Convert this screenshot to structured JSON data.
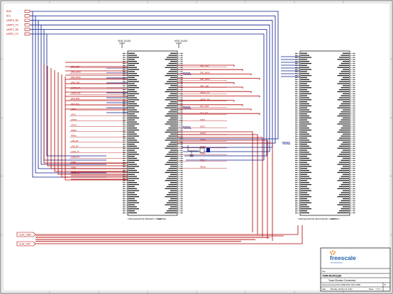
{
  "colors": {
    "red": "#b00000",
    "blue": "#0b1b8a",
    "black": "#000000",
    "border": "#555555",
    "logo_blue": "#1f5fae",
    "logo_orange": "#f28c1e"
  },
  "offsheet_labels": [
    "SDA",
    "SCL",
    "UART0_RX",
    "UART0_TX",
    "UART1_RX",
    "UART1_TX"
  ],
  "connector_a": {
    "rail_left": "VDD_ELEV",
    "rail_right": "VDD_ELEV",
    "ref": "J1",
    "part": "TWR ELEVATOR PRIMARY CONN",
    "type": "SAMTEC"
  },
  "connector_b": {
    "ref": "J2",
    "part": "TWR ELEVATOR SECONDARY CONN",
    "type": "SAMTEC"
  },
  "net_labels_left": [
    "SPI0_SCK",
    "SPI0_MOSI",
    "SPI0_MISO",
    "SPI0_CS0",
    "UART0_TX",
    "UART0_RX",
    "I2C0_SDA",
    "I2C0_SCL",
    "ADC0",
    "ADC1",
    "GPIO0",
    "GPIO1",
    "PWM0",
    "PWM1",
    "USB_DP",
    "USB_DN",
    "CAN0_TX",
    "CAN0_RX",
    "TMR0",
    "TMR1",
    "RESET_B"
  ],
  "net_labels_right": [
    "SPI1_SCK",
    "SPI1_MOSI",
    "SPI1_MISO",
    "SPI1_CS0",
    "UART1_TX",
    "UART1_RX",
    "I2C1_SDA",
    "I2C1_SCL",
    "ADC2",
    "ADC3",
    "GPIO2",
    "GPIO3",
    "PWM2",
    "PWM3",
    "IRQ_A",
    "IRQ_B"
  ],
  "power_labels": [
    "3.3V_VDD",
    "3.3V_VIO"
  ],
  "title_block": {
    "company": "freescale",
    "tagline": "semiconductor",
    "title": "TWR-MCF51QM",
    "subtitle": "Tower Elevator Connectors",
    "drawing_no": "SCH-27890 PDF: SPF-27890",
    "size": "B",
    "rev": "B",
    "sheet": "7 of 7",
    "date": "Monday, October 22, 2012",
    "row_labels": [
      "Size",
      "Document Number",
      "Rev",
      "Date:",
      "Sheet"
    ]
  }
}
